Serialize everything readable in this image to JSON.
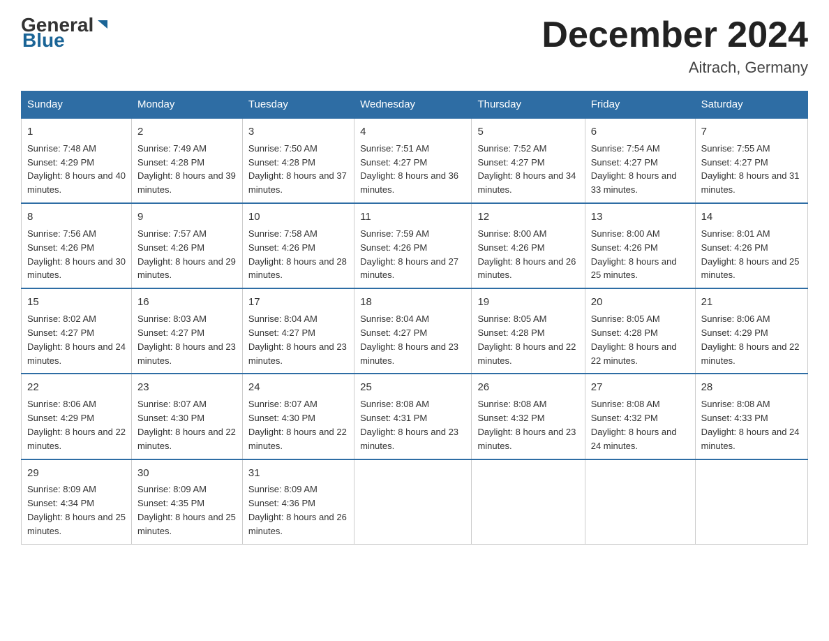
{
  "header": {
    "logo_general": "General",
    "logo_blue": "Blue",
    "title": "December 2024",
    "subtitle": "Aitrach, Germany"
  },
  "columns": [
    "Sunday",
    "Monday",
    "Tuesday",
    "Wednesday",
    "Thursday",
    "Friday",
    "Saturday"
  ],
  "weeks": [
    [
      {
        "day": "1",
        "sunrise": "7:48 AM",
        "sunset": "4:29 PM",
        "daylight": "8 hours and 40 minutes."
      },
      {
        "day": "2",
        "sunrise": "7:49 AM",
        "sunset": "4:28 PM",
        "daylight": "8 hours and 39 minutes."
      },
      {
        "day": "3",
        "sunrise": "7:50 AM",
        "sunset": "4:28 PM",
        "daylight": "8 hours and 37 minutes."
      },
      {
        "day": "4",
        "sunrise": "7:51 AM",
        "sunset": "4:27 PM",
        "daylight": "8 hours and 36 minutes."
      },
      {
        "day": "5",
        "sunrise": "7:52 AM",
        "sunset": "4:27 PM",
        "daylight": "8 hours and 34 minutes."
      },
      {
        "day": "6",
        "sunrise": "7:54 AM",
        "sunset": "4:27 PM",
        "daylight": "8 hours and 33 minutes."
      },
      {
        "day": "7",
        "sunrise": "7:55 AM",
        "sunset": "4:27 PM",
        "daylight": "8 hours and 31 minutes."
      }
    ],
    [
      {
        "day": "8",
        "sunrise": "7:56 AM",
        "sunset": "4:26 PM",
        "daylight": "8 hours and 30 minutes."
      },
      {
        "day": "9",
        "sunrise": "7:57 AM",
        "sunset": "4:26 PM",
        "daylight": "8 hours and 29 minutes."
      },
      {
        "day": "10",
        "sunrise": "7:58 AM",
        "sunset": "4:26 PM",
        "daylight": "8 hours and 28 minutes."
      },
      {
        "day": "11",
        "sunrise": "7:59 AM",
        "sunset": "4:26 PM",
        "daylight": "8 hours and 27 minutes."
      },
      {
        "day": "12",
        "sunrise": "8:00 AM",
        "sunset": "4:26 PM",
        "daylight": "8 hours and 26 minutes."
      },
      {
        "day": "13",
        "sunrise": "8:00 AM",
        "sunset": "4:26 PM",
        "daylight": "8 hours and 25 minutes."
      },
      {
        "day": "14",
        "sunrise": "8:01 AM",
        "sunset": "4:26 PM",
        "daylight": "8 hours and 25 minutes."
      }
    ],
    [
      {
        "day": "15",
        "sunrise": "8:02 AM",
        "sunset": "4:27 PM",
        "daylight": "8 hours and 24 minutes."
      },
      {
        "day": "16",
        "sunrise": "8:03 AM",
        "sunset": "4:27 PM",
        "daylight": "8 hours and 23 minutes."
      },
      {
        "day": "17",
        "sunrise": "8:04 AM",
        "sunset": "4:27 PM",
        "daylight": "8 hours and 23 minutes."
      },
      {
        "day": "18",
        "sunrise": "8:04 AM",
        "sunset": "4:27 PM",
        "daylight": "8 hours and 23 minutes."
      },
      {
        "day": "19",
        "sunrise": "8:05 AM",
        "sunset": "4:28 PM",
        "daylight": "8 hours and 22 minutes."
      },
      {
        "day": "20",
        "sunrise": "8:05 AM",
        "sunset": "4:28 PM",
        "daylight": "8 hours and 22 minutes."
      },
      {
        "day": "21",
        "sunrise": "8:06 AM",
        "sunset": "4:29 PM",
        "daylight": "8 hours and 22 minutes."
      }
    ],
    [
      {
        "day": "22",
        "sunrise": "8:06 AM",
        "sunset": "4:29 PM",
        "daylight": "8 hours and 22 minutes."
      },
      {
        "day": "23",
        "sunrise": "8:07 AM",
        "sunset": "4:30 PM",
        "daylight": "8 hours and 22 minutes."
      },
      {
        "day": "24",
        "sunrise": "8:07 AM",
        "sunset": "4:30 PM",
        "daylight": "8 hours and 22 minutes."
      },
      {
        "day": "25",
        "sunrise": "8:08 AM",
        "sunset": "4:31 PM",
        "daylight": "8 hours and 23 minutes."
      },
      {
        "day": "26",
        "sunrise": "8:08 AM",
        "sunset": "4:32 PM",
        "daylight": "8 hours and 23 minutes."
      },
      {
        "day": "27",
        "sunrise": "8:08 AM",
        "sunset": "4:32 PM",
        "daylight": "8 hours and 24 minutes."
      },
      {
        "day": "28",
        "sunrise": "8:08 AM",
        "sunset": "4:33 PM",
        "daylight": "8 hours and 24 minutes."
      }
    ],
    [
      {
        "day": "29",
        "sunrise": "8:09 AM",
        "sunset": "4:34 PM",
        "daylight": "8 hours and 25 minutes."
      },
      {
        "day": "30",
        "sunrise": "8:09 AM",
        "sunset": "4:35 PM",
        "daylight": "8 hours and 25 minutes."
      },
      {
        "day": "31",
        "sunrise": "8:09 AM",
        "sunset": "4:36 PM",
        "daylight": "8 hours and 26 minutes."
      },
      null,
      null,
      null,
      null
    ]
  ],
  "labels": {
    "sunrise": "Sunrise:",
    "sunset": "Sunset:",
    "daylight": "Daylight:"
  }
}
